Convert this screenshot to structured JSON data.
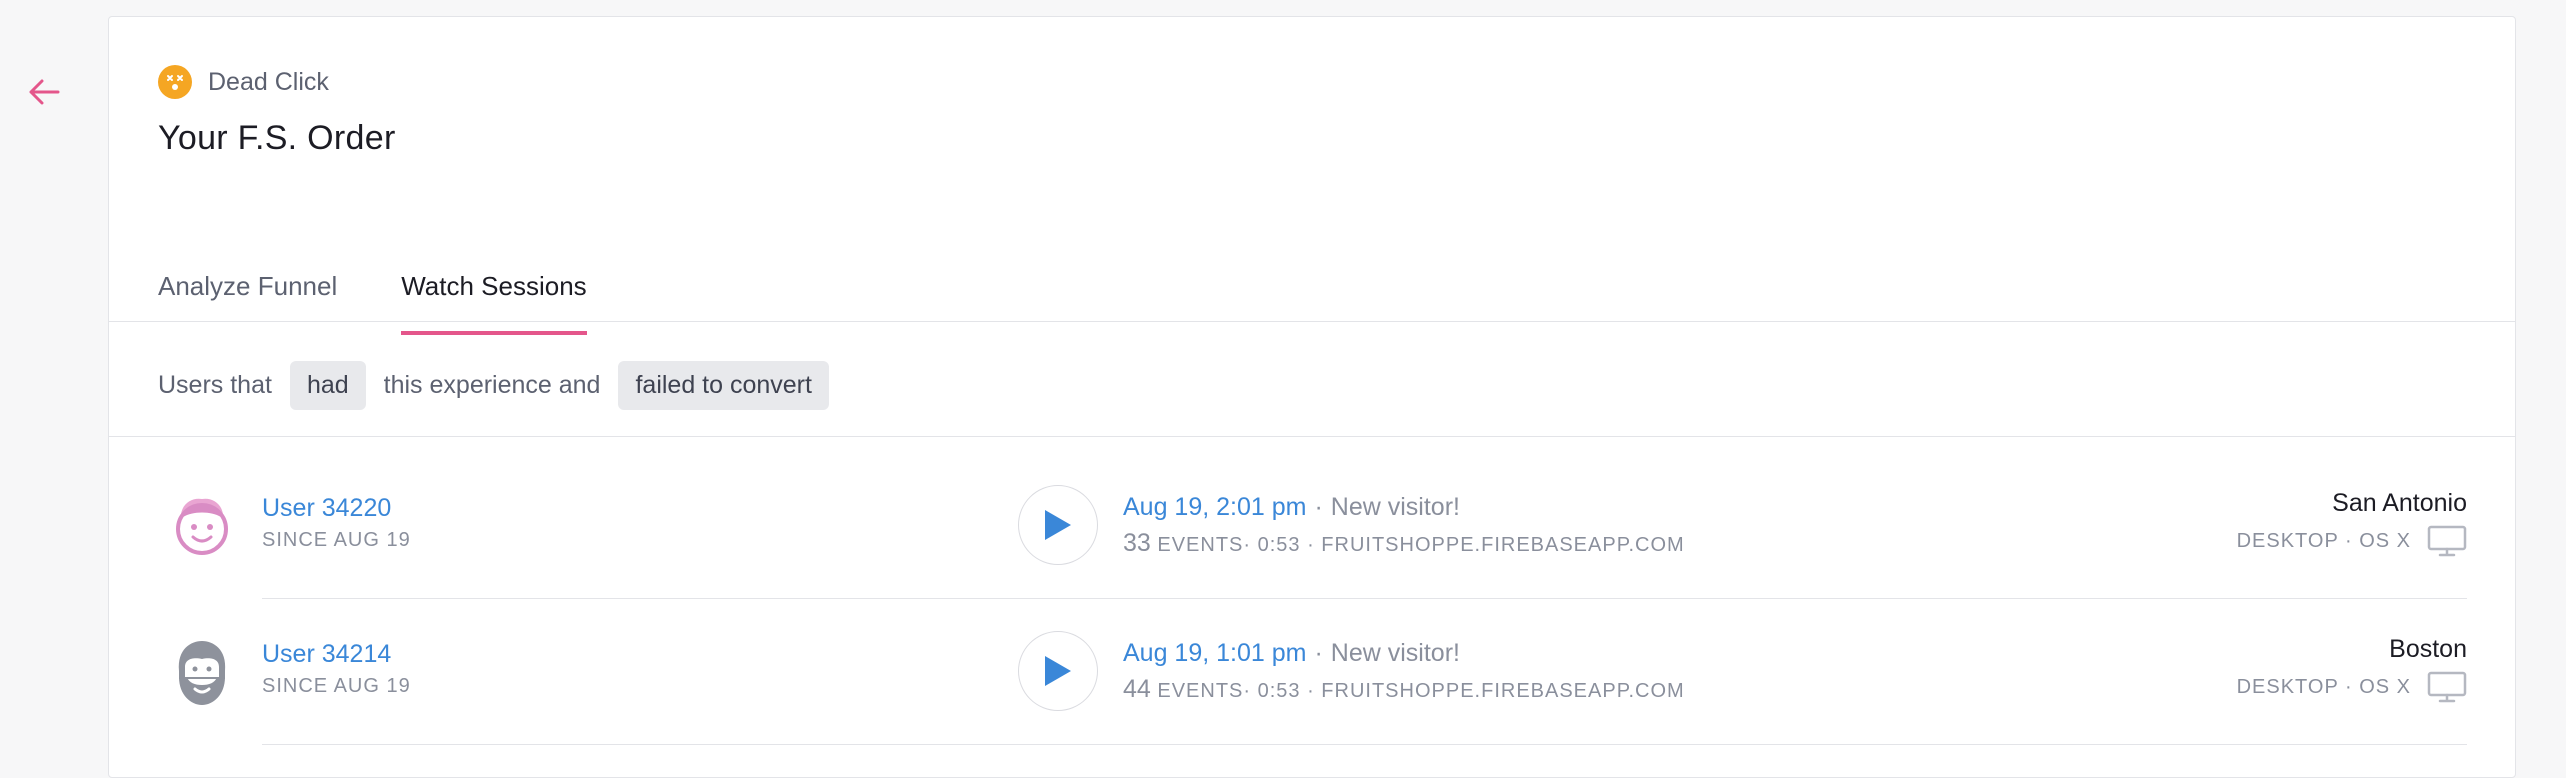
{
  "nav": {
    "back_icon": "arrow-left-icon",
    "accent": "#e4568b"
  },
  "header": {
    "type_icon": "dead-click-face-icon",
    "type_label": "Dead Click",
    "title": "Your F.S. Order"
  },
  "tabs": [
    {
      "label": "Analyze Funnel",
      "active": false
    },
    {
      "label": "Watch Sessions",
      "active": true
    }
  ],
  "filter": {
    "prefix": "Users that",
    "pill1": "had",
    "middle": "this experience and",
    "pill2": "failed to convert"
  },
  "sessions": [
    {
      "user": "User 34220",
      "since": "Since Aug 19",
      "avatar_icon": "user-avatar-pink-icon",
      "date": "Aug 19, 2:01 pm",
      "visitor": "New visitor!",
      "events_count": "33",
      "events_rest": " EVENTS· 0:53 · FRUITSHOPPE.FIREBASEAPP.COM",
      "city": "San Antonio",
      "device": "DESKTOP · OS X",
      "device_icon": "monitor-icon"
    },
    {
      "user": "User 34214",
      "since": "Since Aug 19",
      "avatar_icon": "user-avatar-gray-bearded-icon",
      "date": "Aug 19, 1:01 pm",
      "visitor": "New visitor!",
      "events_count": "44",
      "events_rest": " EVENTS· 0:53 · FRUITSHOPPE.FIREBASEAPP.COM",
      "city": "Boston",
      "device": "DESKTOP · OS X",
      "device_icon": "monitor-icon"
    }
  ],
  "colors": {
    "link": "#3a87d8",
    "muted": "#8a8f9c",
    "play": "#3a87d8",
    "warning": "#f5a623"
  }
}
